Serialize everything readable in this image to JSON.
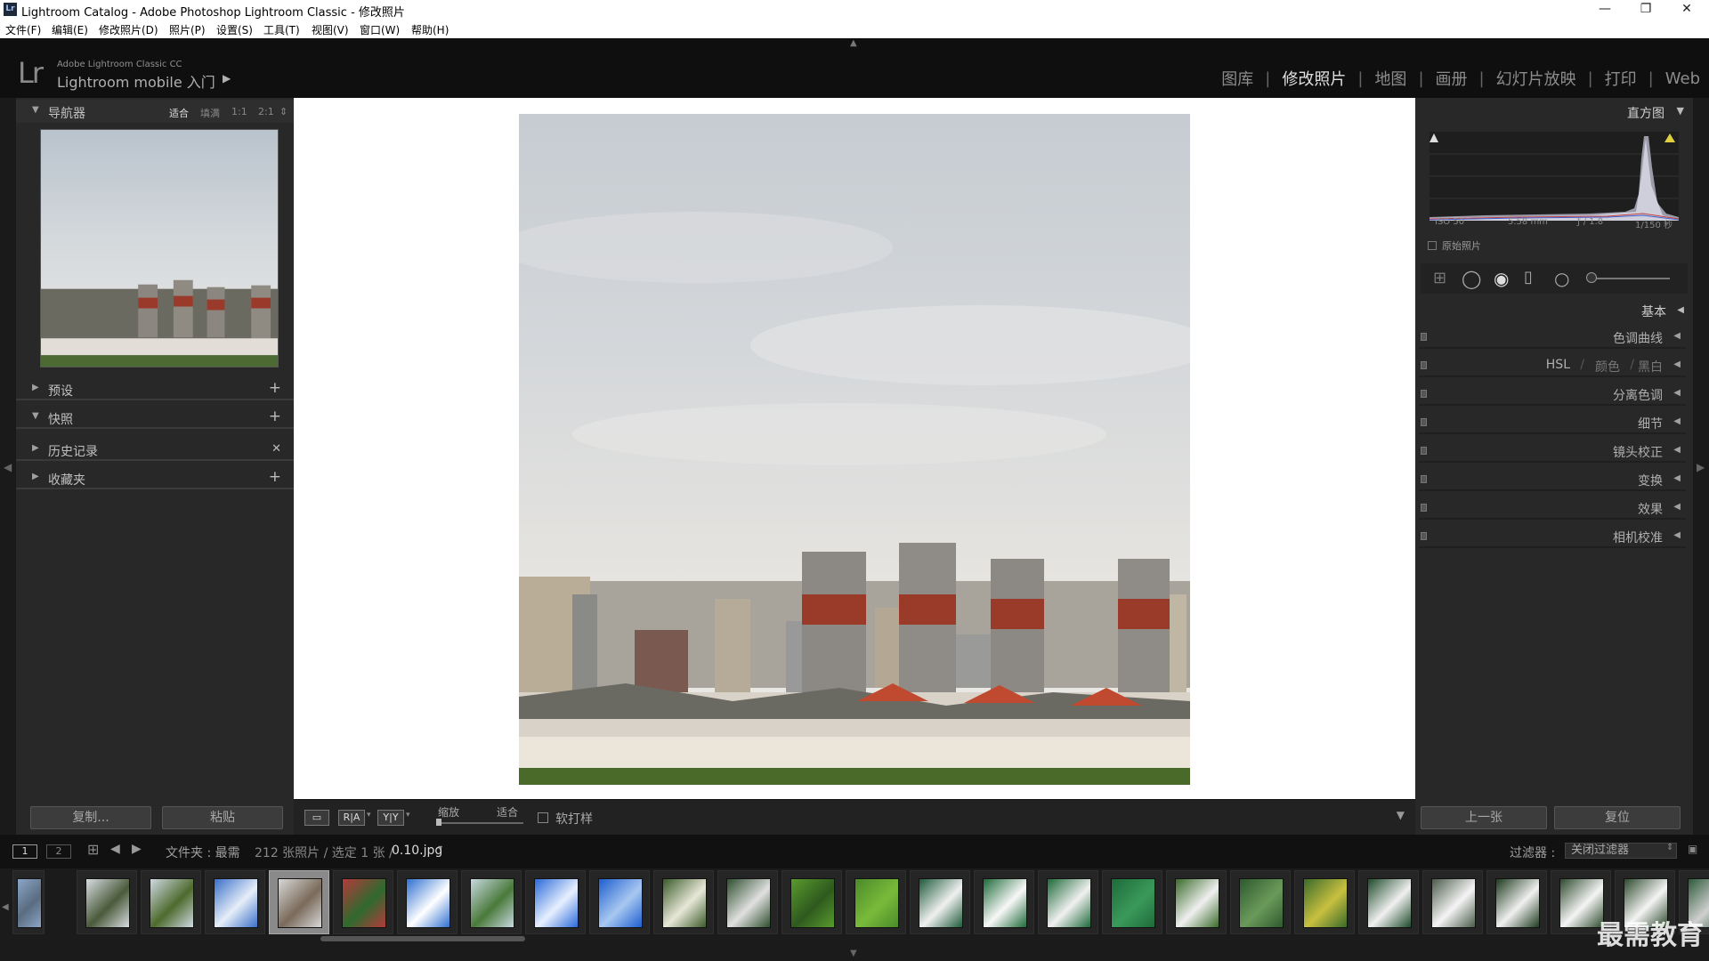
{
  "window": {
    "title": "Lightroom Catalog - Adobe Photoshop Lightroom Classic - 修改照片",
    "app_icon": "Lr",
    "minimize": "—",
    "restore": "❐",
    "close": "✕"
  },
  "menu": [
    "文件(F)",
    "编辑(E)",
    "修改照片(D)",
    "照片(P)",
    "设置(S)",
    "工具(T)",
    "视图(V)",
    "窗口(W)",
    "帮助(H)"
  ],
  "identity": {
    "logo": "Lr",
    "line1": "Adobe Lightroom Classic CC",
    "line2": "Lightroom mobile 入门",
    "arrow": "▶"
  },
  "modules": [
    "图库",
    "修改照片",
    "地图",
    "画册",
    "幻灯片放映",
    "打印",
    "Web"
  ],
  "active_module": "修改照片",
  "left_panel": {
    "navigator": {
      "title": "导航器",
      "opts": [
        "适合",
        "填满",
        "1:1",
        "2:1"
      ]
    },
    "sections": [
      {
        "label": "预设",
        "action": "+"
      },
      {
        "label": "快照",
        "action": "+"
      },
      {
        "label": "历史记录",
        "action": "✕"
      },
      {
        "label": "收藏夹",
        "action": "+"
      }
    ],
    "copy_btn": "复制...",
    "paste_btn": "粘贴"
  },
  "right_panel": {
    "histogram_title": "直方图",
    "exif": {
      "iso": "ISO 50",
      "focal": "5.58 mm",
      "aperture": "ƒ / 1.8",
      "shutter": "1/150 秒"
    },
    "original_photo": "原始照片",
    "basic": "基本",
    "sections": [
      "色调曲线",
      "分离色调",
      "细节",
      "镜头校正",
      "变换",
      "效果",
      "相机校准"
    ],
    "hsl": {
      "a": "HSL",
      "b": "颜色",
      "c": "黑白"
    },
    "prev_btn": "上一张",
    "reset_btn": "复位"
  },
  "toolbar": {
    "zoom_label": "缩放",
    "fit_label": "适合",
    "softproof": "软打样",
    "icon_ra": "R|A",
    "icon_yy": "Y|Y"
  },
  "filmstrip_bar": {
    "view1": "1",
    "view2": "2",
    "source": "文件夹 : 最需",
    "count": "212 张照片 / 选定 1 张 /",
    "file": "0.10.jpg",
    "filter_label": "过滤器 :",
    "filter_value": "关闭过滤器"
  },
  "watermark": "最需教育",
  "thumbs": [
    {
      "c1": "#8aa6c8",
      "c2": "#5a6c80"
    },
    {
      "c1": "#d8dde2",
      "c2": "#4a5a3a"
    },
    {
      "c1": "#cfd9e2",
      "c2": "#4e6a2e"
    },
    {
      "c1": "#3a6fc8",
      "c2": "#e6eef8"
    },
    {
      "c1": "#d8d8d8",
      "c2": "#7a6a5a"
    },
    {
      "c1": "#b43a3a",
      "c2": "#2e6a2e"
    },
    {
      "c1": "#2f6fd0",
      "c2": "#ffffff"
    },
    {
      "c1": "#c8d8e0",
      "c2": "#4a7a3a"
    },
    {
      "c1": "#2a6ad8",
      "c2": "#e8f0ff"
    },
    {
      "c1": "#1e5ed0",
      "c2": "#a8c8f0"
    },
    {
      "c1": "#3a5a2a",
      "c2": "#e8e8d8"
    },
    {
      "c1": "#2e4e2e",
      "c2": "#e0e0e0"
    },
    {
      "c1": "#5a9a2e",
      "c2": "#2e5a1e"
    },
    {
      "c1": "#4a8a2a",
      "c2": "#7aba3a"
    },
    {
      "c1": "#1e5a3a",
      "c2": "#f0f0f0"
    },
    {
      "c1": "#1e6a3a",
      "c2": "#f8f8f8"
    },
    {
      "c1": "#1e6a3a",
      "c2": "#f0f0f0"
    },
    {
      "c1": "#1e6a3a",
      "c2": "#3a9a5a"
    },
    {
      "c1": "#3a6a2a",
      "c2": "#f0f0f0"
    },
    {
      "c1": "#2e5a2e",
      "c2": "#6a9a5a"
    },
    {
      "c1": "#3a6a2a",
      "c2": "#c8c040"
    },
    {
      "c1": "#1e4a2a",
      "c2": "#f0f0f0"
    },
    {
      "c1": "#4a5a4a",
      "c2": "#f4f4f4"
    },
    {
      "c1": "#1e3a1e",
      "c2": "#f0f0f0"
    },
    {
      "c1": "#2e4a2e",
      "c2": "#f4f4f4"
    },
    {
      "c1": "#2e4a2e",
      "c2": "#f4f4f4"
    },
    {
      "c1": "#2e5a3a",
      "c2": "#d0d0d0"
    }
  ]
}
